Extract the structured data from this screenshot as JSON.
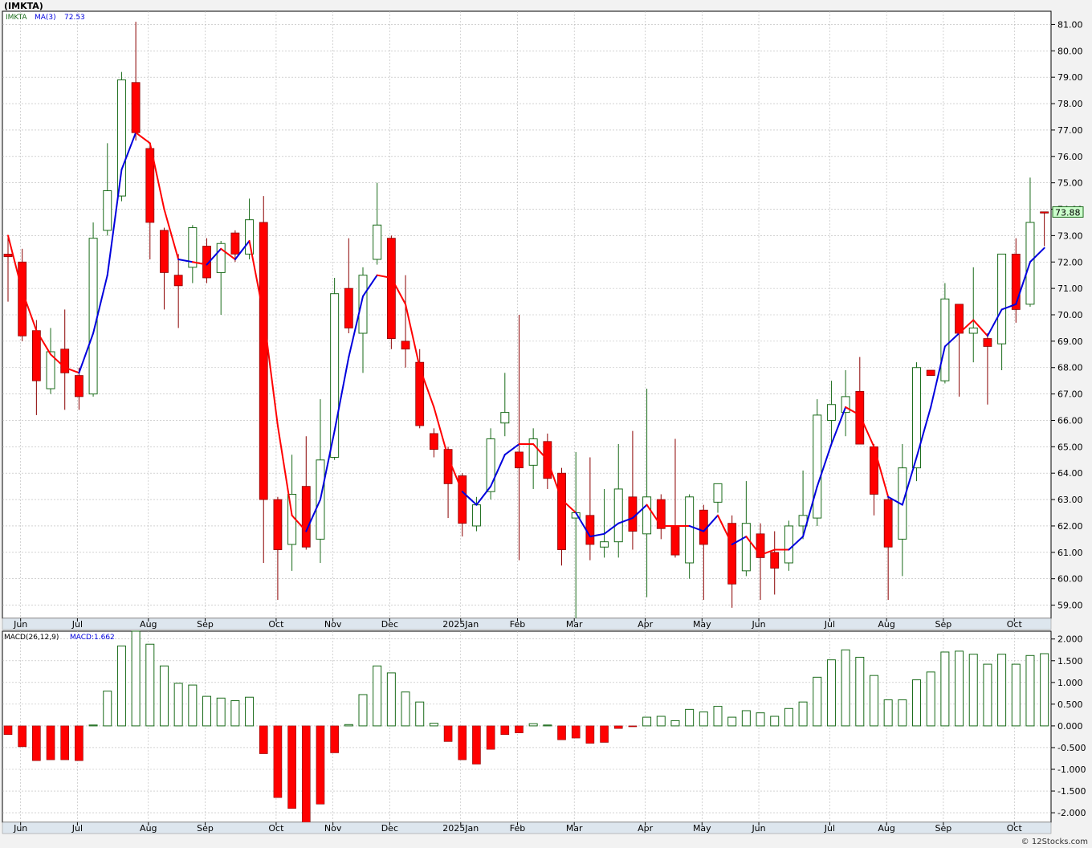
{
  "header": {
    "title": "(IMKTA)"
  },
  "footer": {
    "credit": "© 12Stocks.com"
  },
  "colors": {
    "up": "#1a6b1a",
    "down": "#ff0000",
    "ma": "#0000dd",
    "ma_red": "#ff0000",
    "grid": "#b8b8b8",
    "axis_bg": "#dde6ee"
  },
  "chart_data": [
    {
      "type": "candlestick",
      "panel": "price",
      "legend": {
        "symbol": "IMKTA",
        "ma_label": "MA(3)",
        "ma_value": "72.53"
      },
      "last_price_label": "73.88",
      "ylim": [
        58.5,
        81.5
      ],
      "yticks": [
        "59.00",
        "60.00",
        "61.00",
        "62.00",
        "63.00",
        "64.00",
        "65.00",
        "66.00",
        "67.00",
        "68.00",
        "69.00",
        "70.00",
        "71.00",
        "72.00",
        "73.00",
        "74.00",
        "75.00",
        "76.00",
        "77.00",
        "78.00",
        "79.00",
        "80.00",
        "81.00"
      ],
      "x_labels": [
        {
          "label": "Jun",
          "i": 1
        },
        {
          "label": "Jul",
          "i": 5
        },
        {
          "label": "Aug",
          "i": 10
        },
        {
          "label": "Sep",
          "i": 14
        },
        {
          "label": "Oct",
          "i": 19
        },
        {
          "label": "Nov",
          "i": 23
        },
        {
          "label": "Dec",
          "i": 27
        },
        {
          "label": "2025Jan",
          "i": 32
        },
        {
          "label": "Feb",
          "i": 36
        },
        {
          "label": "Mar",
          "i": 40
        },
        {
          "label": "Apr",
          "i": 45
        },
        {
          "label": "May",
          "i": 49
        },
        {
          "label": "Jun",
          "i": 53
        },
        {
          "label": "Jul",
          "i": 58
        },
        {
          "label": "Aug",
          "i": 62
        },
        {
          "label": "Sep",
          "i": 66
        },
        {
          "label": "Oct",
          "i": 71
        }
      ],
      "candles": [
        {
          "o": 72.3,
          "h": 73.0,
          "l": 70.5,
          "c": 72.2
        },
        {
          "o": 72.0,
          "h": 72.5,
          "l": 69.0,
          "c": 69.2
        },
        {
          "o": 69.4,
          "h": 69.8,
          "l": 66.2,
          "c": 67.5
        },
        {
          "o": 67.2,
          "h": 69.5,
          "l": 67.0,
          "c": 68.6
        },
        {
          "o": 68.7,
          "h": 70.2,
          "l": 66.4,
          "c": 67.8
        },
        {
          "o": 67.7,
          "h": 68.0,
          "l": 66.4,
          "c": 66.9
        },
        {
          "o": 67.0,
          "h": 73.5,
          "l": 66.9,
          "c": 72.9
        },
        {
          "o": 73.2,
          "h": 76.5,
          "l": 73.0,
          "c": 74.7
        },
        {
          "o": 74.5,
          "h": 79.2,
          "l": 74.3,
          "c": 78.9
        },
        {
          "o": 78.8,
          "h": 81.1,
          "l": 76.6,
          "c": 76.9
        },
        {
          "o": 76.3,
          "h": 76.5,
          "l": 72.1,
          "c": 73.5
        },
        {
          "o": 73.2,
          "h": 73.3,
          "l": 70.2,
          "c": 71.6
        },
        {
          "o": 71.5,
          "h": 72.3,
          "l": 69.5,
          "c": 71.1
        },
        {
          "o": 71.8,
          "h": 73.4,
          "l": 71.2,
          "c": 73.3
        },
        {
          "o": 72.6,
          "h": 72.9,
          "l": 71.2,
          "c": 71.4
        },
        {
          "o": 71.6,
          "h": 72.8,
          "l": 70.0,
          "c": 72.7
        },
        {
          "o": 73.1,
          "h": 73.2,
          "l": 72.0,
          "c": 72.3
        },
        {
          "o": 72.3,
          "h": 74.4,
          "l": 72.1,
          "c": 73.6
        },
        {
          "o": 73.5,
          "h": 74.5,
          "l": 60.6,
          "c": 63.0
        },
        {
          "o": 63.0,
          "h": 63.1,
          "l": 59.2,
          "c": 61.1
        },
        {
          "o": 61.3,
          "h": 64.7,
          "l": 60.3,
          "c": 63.2
        },
        {
          "o": 63.5,
          "h": 65.4,
          "l": 61.1,
          "c": 61.2
        },
        {
          "o": 61.5,
          "h": 66.8,
          "l": 60.6,
          "c": 64.5
        },
        {
          "o": 64.6,
          "h": 71.4,
          "l": 64.5,
          "c": 70.8
        },
        {
          "o": 71.0,
          "h": 72.9,
          "l": 69.3,
          "c": 69.5
        },
        {
          "o": 69.3,
          "h": 71.8,
          "l": 67.8,
          "c": 71.5
        },
        {
          "o": 72.1,
          "h": 75.0,
          "l": 71.9,
          "c": 73.4
        },
        {
          "o": 72.9,
          "h": 73.0,
          "l": 68.7,
          "c": 69.1
        },
        {
          "o": 69.0,
          "h": 71.5,
          "l": 68.0,
          "c": 68.7
        },
        {
          "o": 68.2,
          "h": 68.7,
          "l": 65.7,
          "c": 65.8
        },
        {
          "o": 65.5,
          "h": 65.7,
          "l": 64.6,
          "c": 64.9
        },
        {
          "o": 64.9,
          "h": 65.0,
          "l": 62.3,
          "c": 63.6
        },
        {
          "o": 63.9,
          "h": 64.0,
          "l": 61.6,
          "c": 62.1
        },
        {
          "o": 62.0,
          "h": 63.1,
          "l": 61.8,
          "c": 62.8
        },
        {
          "o": 63.3,
          "h": 65.7,
          "l": 63.0,
          "c": 65.3
        },
        {
          "o": 65.9,
          "h": 67.8,
          "l": 65.4,
          "c": 66.3
        },
        {
          "o": 64.8,
          "h": 70.0,
          "l": 60.7,
          "c": 64.2
        },
        {
          "o": 64.3,
          "h": 65.7,
          "l": 63.4,
          "c": 65.3
        },
        {
          "o": 65.2,
          "h": 65.5,
          "l": 63.4,
          "c": 63.8
        },
        {
          "o": 64.0,
          "h": 64.2,
          "l": 60.5,
          "c": 61.1
        },
        {
          "o": 62.3,
          "h": 64.8,
          "l": 58.5,
          "c": 62.5
        },
        {
          "o": 62.4,
          "h": 64.6,
          "l": 60.7,
          "c": 61.3
        },
        {
          "o": 61.2,
          "h": 63.4,
          "l": 60.8,
          "c": 61.4
        },
        {
          "o": 61.4,
          "h": 65.1,
          "l": 60.8,
          "c": 63.4
        },
        {
          "o": 63.1,
          "h": 65.6,
          "l": 61.1,
          "c": 61.8
        },
        {
          "o": 61.7,
          "h": 67.2,
          "l": 59.3,
          "c": 63.1
        },
        {
          "o": 63.0,
          "h": 63.2,
          "l": 61.5,
          "c": 61.9
        },
        {
          "o": 62.0,
          "h": 65.3,
          "l": 60.8,
          "c": 60.9
        },
        {
          "o": 60.6,
          "h": 63.2,
          "l": 60.0,
          "c": 63.1
        },
        {
          "o": 62.6,
          "h": 62.8,
          "l": 59.2,
          "c": 61.3
        },
        {
          "o": 62.9,
          "h": 63.5,
          "l": 62.5,
          "c": 63.6
        },
        {
          "o": 62.1,
          "h": 62.4,
          "l": 58.9,
          "c": 59.8
        },
        {
          "o": 60.3,
          "h": 63.7,
          "l": 60.1,
          "c": 62.1
        },
        {
          "o": 61.7,
          "h": 62.1,
          "l": 59.2,
          "c": 60.8
        },
        {
          "o": 61.0,
          "h": 61.8,
          "l": 59.4,
          "c": 60.4
        },
        {
          "o": 60.6,
          "h": 62.2,
          "l": 60.3,
          "c": 62.0
        },
        {
          "o": 62.0,
          "h": 64.1,
          "l": 61.5,
          "c": 62.4
        },
        {
          "o": 62.3,
          "h": 66.8,
          "l": 62.0,
          "c": 66.2
        },
        {
          "o": 66.0,
          "h": 67.5,
          "l": 65.1,
          "c": 66.6
        },
        {
          "o": 66.3,
          "h": 67.9,
          "l": 65.4,
          "c": 66.9
        },
        {
          "o": 67.1,
          "h": 68.4,
          "l": 65.1,
          "c": 65.1
        },
        {
          "o": 65.0,
          "h": 65.1,
          "l": 62.4,
          "c": 63.2
        },
        {
          "o": 63.0,
          "h": 63.1,
          "l": 59.2,
          "c": 61.2
        },
        {
          "o": 61.5,
          "h": 65.1,
          "l": 60.1,
          "c": 64.2
        },
        {
          "o": 64.2,
          "h": 68.2,
          "l": 63.7,
          "c": 68.0
        },
        {
          "o": 67.9,
          "h": 67.9,
          "l": 67.7,
          "c": 67.7
        },
        {
          "o": 67.5,
          "h": 71.2,
          "l": 67.4,
          "c": 70.6
        },
        {
          "o": 70.4,
          "h": 70.4,
          "l": 66.9,
          "c": 69.3
        },
        {
          "o": 69.3,
          "h": 71.8,
          "l": 68.2,
          "c": 69.5
        },
        {
          "o": 69.1,
          "h": 69.3,
          "l": 66.6,
          "c": 68.8
        },
        {
          "o": 68.9,
          "h": 72.3,
          "l": 67.9,
          "c": 72.3
        },
        {
          "o": 72.3,
          "h": 72.9,
          "l": 69.7,
          "c": 70.2
        },
        {
          "o": 70.4,
          "h": 75.2,
          "l": 70.3,
          "c": 73.5
        },
        {
          "o": 73.9,
          "h": 73.9,
          "l": 72.6,
          "c": 73.88
        }
      ],
      "ma3": [
        73.0,
        70.9,
        69.4,
        68.5,
        68.0,
        67.8,
        69.3,
        71.5,
        75.5,
        76.9,
        76.5,
        74.0,
        72.1,
        72.0,
        71.9,
        72.5,
        72.1,
        72.8,
        70.0,
        65.8,
        62.4,
        61.8,
        63.0,
        65.6,
        68.4,
        70.7,
        71.5,
        71.4,
        70.4,
        68.0,
        66.5,
        64.6,
        63.3,
        62.8,
        63.5,
        64.7,
        65.1,
        65.1,
        64.5,
        63.0,
        62.5,
        61.6,
        61.7,
        62.1,
        62.3,
        62.8,
        62.0,
        62.0,
        62.0,
        61.8,
        62.4,
        61.3,
        61.6,
        60.9,
        61.1,
        61.1,
        61.6,
        63.5,
        65.1,
        66.5,
        66.2,
        65.0,
        63.1,
        62.8,
        64.6,
        66.5,
        68.8,
        69.3,
        69.8,
        69.2,
        70.2,
        70.4,
        72.0,
        72.53
      ],
      "ma_color_by_bar": [
        "r",
        "r",
        "r",
        "r",
        "r",
        "r",
        "b",
        "b",
        "b",
        "b",
        "r",
        "r",
        "r",
        "b",
        "r",
        "b",
        "r",
        "b",
        "r",
        "r",
        "r",
        "r",
        "b",
        "b",
        "b",
        "b",
        "b",
        "r",
        "r",
        "r",
        "r",
        "r",
        "r",
        "b",
        "b",
        "b",
        "b",
        "r",
        "r",
        "r",
        "r",
        "b",
        "b",
        "b",
        "b",
        "b",
        "r",
        "r",
        "r",
        "b",
        "b",
        "r",
        "b",
        "r",
        "r",
        "r",
        "b",
        "b",
        "b",
        "b",
        "r",
        "r",
        "r",
        "b",
        "b",
        "b",
        "b",
        "b",
        "r",
        "r",
        "b",
        "b",
        "b",
        "b"
      ]
    },
    {
      "type": "bar",
      "panel": "macd",
      "legend": {
        "name": "MACD(26,12,9)",
        "value_label": "MACD:1.662"
      },
      "ylim": [
        -2.22,
        2.18
      ],
      "yticks": [
        "-2.000",
        "-1.500",
        "-1.000",
        "-0.500",
        "0.000",
        "0.500",
        "1.000",
        "1.500",
        "2.000"
      ],
      "values": [
        -0.2,
        -0.48,
        -0.8,
        -0.78,
        -0.78,
        -0.8,
        0.02,
        0.8,
        1.84,
        2.18,
        1.88,
        1.38,
        0.98,
        0.94,
        0.68,
        0.64,
        0.58,
        0.66,
        -0.64,
        -1.65,
        -1.9,
        -2.22,
        -1.8,
        -0.62,
        0.03,
        0.72,
        1.38,
        1.22,
        0.78,
        0.55,
        0.06,
        -0.36,
        -0.78,
        -0.88,
        -0.54,
        -0.2,
        -0.16,
        0.05,
        0.02,
        -0.32,
        -0.28,
        -0.4,
        -0.38,
        -0.06,
        -0.02,
        0.2,
        0.22,
        0.12,
        0.38,
        0.32,
        0.45,
        0.2,
        0.35,
        0.3,
        0.22,
        0.4,
        0.55,
        1.12,
        1.52,
        1.75,
        1.58,
        1.16,
        0.6,
        0.6,
        1.06,
        1.24,
        1.7,
        1.72,
        1.65,
        1.42,
        1.65,
        1.42,
        1.62,
        1.662
      ]
    }
  ]
}
